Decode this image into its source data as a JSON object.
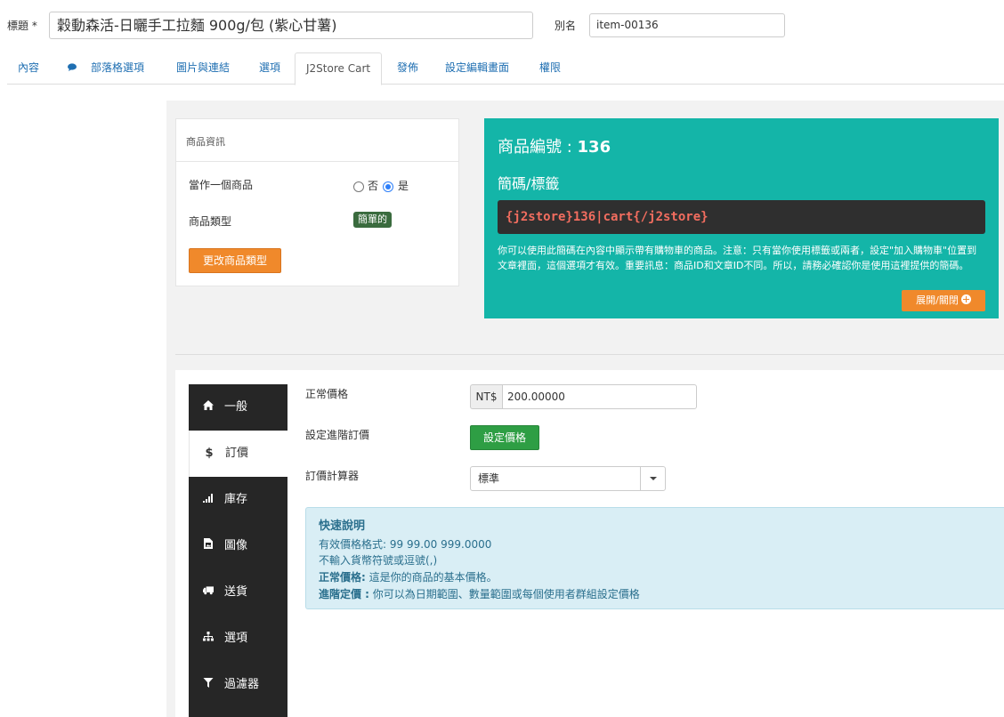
{
  "header": {
    "title_label": "標題 *",
    "title_value": "穀動森活-日曬手工拉麵 900g/包 (紫心甘薯)",
    "alias_label": "別名",
    "alias_value": "item-00136"
  },
  "tabs": [
    {
      "label": "內容"
    },
    {
      "label": "部落格選項"
    },
    {
      "label": "圖片與連結"
    },
    {
      "label": "選項"
    },
    {
      "label": "J2Store Cart"
    },
    {
      "label": "發佈"
    },
    {
      "label": "設定編輯畫面"
    },
    {
      "label": "權限"
    }
  ],
  "product_info": {
    "header": "商品資訊",
    "treat_as_product_label": "當作一個商品",
    "radio_no": "否",
    "radio_yes": "是",
    "product_type_label": "商品類型",
    "product_type_value": "簡單的",
    "change_type_button": "更改商品類型"
  },
  "shortcode_panel": {
    "product_id_label": "商品編號 : ",
    "product_id_value": "136",
    "tags_title": "簡碼/標籤",
    "shortcode": "{j2store}136|cart{/j2store}",
    "note": "你可以使用此簡碼在內容中顯示帶有購物車的商品。注意：只有當你使用標籤或兩者，設定\"加入購物車\"位置到文章裡面，這個選項才有效。重要訊息：商品ID和文章ID不同。所以，請務必確認你是使用這裡提供的簡碼。",
    "toggle_button": "展開/關閉"
  },
  "sidebar": [
    {
      "label": "一般",
      "icon": "home-icon"
    },
    {
      "label": "訂價",
      "icon": "dollar-icon"
    },
    {
      "label": "庫存",
      "icon": "signal-icon"
    },
    {
      "label": "圖像",
      "icon": "image-file-icon"
    },
    {
      "label": "送貨",
      "icon": "truck-icon"
    },
    {
      "label": "選項",
      "icon": "sitemap-icon"
    },
    {
      "label": "過濾器",
      "icon": "filter-icon"
    }
  ],
  "pricing": {
    "regular_price_label": "正常價格",
    "currency": "NT$",
    "regular_price_value": "200.00000",
    "advanced_price_label": "設定進階訂價",
    "set_price_button": "設定價格",
    "calculator_label": "訂價計算器",
    "calculator_value": "標準"
  },
  "help": {
    "title": "快速說明",
    "line1": "有效價格格式: 99 99.00 999.0000",
    "line2": "不輸入貨幣符號或逗號(,)",
    "line3_bold": "正常價格:",
    "line3_rest": " 這是你的商品的基本價格。",
    "line4_bold": "進階定價 :",
    "line4_rest": " 你可以為日期範圍、數量範圍或每個使用者群組設定價格"
  },
  "colors": {
    "teal": "#14b5a8",
    "orange": "#f0892b",
    "green": "#2e9e44",
    "link": "#1f6fb2",
    "sidebar_dark": "#262626"
  }
}
